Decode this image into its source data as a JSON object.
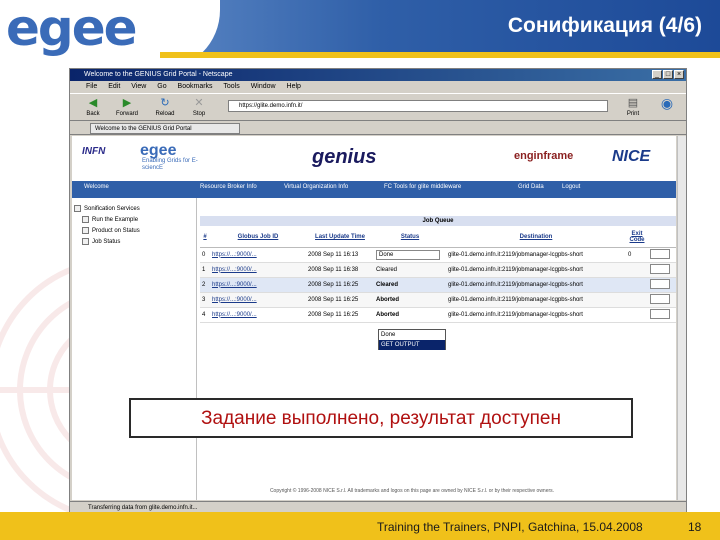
{
  "slide": {
    "logo": "egee",
    "title": "Сонификация (4/6)",
    "caption": "Задание выполнено, результат доступен",
    "footer": "Training the Trainers, PNPI, Gatchina, 15.04.2008",
    "page_number": "18"
  },
  "browser": {
    "window_title": "Welcome to the GENIUS Grid Portal - Netscape",
    "menu": [
      "File",
      "Edit",
      "View",
      "Go",
      "Bookmarks",
      "Tools",
      "Window",
      "Help"
    ],
    "toolbar": {
      "back": "Back",
      "forward": "Forward",
      "reload": "Reload",
      "stop": "Stop",
      "print": "Print"
    },
    "address": "https://glite.demo.infn.it/",
    "tab_label": "Welcome to the GENIUS Grid Portal",
    "status_text": "Transferring data from glite.demo.infn.it..."
  },
  "portal": {
    "partners": {
      "infn": "INFN",
      "egee": "egee",
      "egee_sub": "Enabling Grids for E-sciencE",
      "genius": "genius",
      "enginframe": "enginframe",
      "nice": "NICE"
    },
    "nav": [
      "Welcome",
      "Resource Broker Info",
      "Virtual Organization Info",
      "FC Tools for glite middleware",
      "Grid Data",
      "Logout"
    ],
    "tree": [
      "Sonification Services",
      "Run the Example",
      "Product on Status",
      "Job Status"
    ],
    "table": {
      "caption": "Job Queue",
      "columns": [
        "#",
        "Globus Job ID",
        "Last Update Time",
        "Status",
        "Destination",
        "Exit Code"
      ],
      "rows": [
        {
          "n": "0",
          "id": "https://...:9000/...",
          "time": "2008 Sep 11 16:13",
          "status": "Done",
          "dest": "glite-01.demo.infn.it:2119/jobmanager-lcgpbs-short",
          "exit": "0"
        },
        {
          "n": "1",
          "id": "https://...:9000/...",
          "time": "2008 Sep 11 16:38",
          "status": "Cleared",
          "dest": "glite-01.demo.infn.it:2119/jobmanager-lcgpbs-short",
          "exit": ""
        },
        {
          "n": "2",
          "id": "https://...:9000/...",
          "time": "2008 Sep 11 16:25",
          "status": "Cleared",
          "dest": "glite-01.demo.infn.it:2119/jobmanager-lcgpbs-short",
          "exit": ""
        },
        {
          "n": "3",
          "id": "https://...:9000/...",
          "time": "2008 Sep 11 16:25",
          "status": "Aborted",
          "dest": "glite-01.demo.infn.it:2119/jobmanager-lcgpbs-short",
          "exit": ""
        },
        {
          "n": "4",
          "id": "https://...:9000/...",
          "time": "2008 Sep 11 16:25",
          "status": "Aborted",
          "dest": "glite-01.demo.infn.it:2119/jobmanager-lcgpbs-short",
          "exit": ""
        }
      ],
      "dropdown_options": [
        "Done",
        "GET OUTPUT"
      ]
    },
    "copyright": "Copyright © 1996-2008 NICE S.r.l. All trademarks and logos on this page are owned by NICE S.r.l. or by their respective owners."
  }
}
